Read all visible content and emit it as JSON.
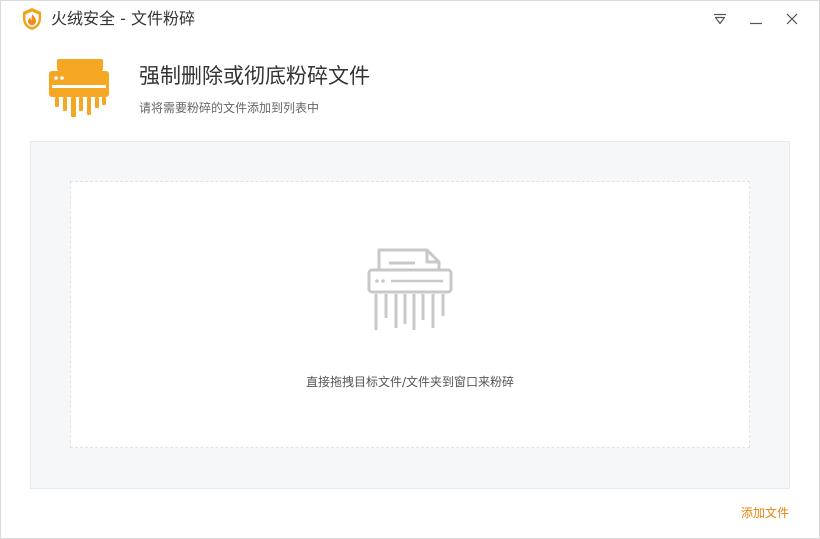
{
  "window": {
    "title": "火绒安全 - 文件粉碎",
    "logo_icon": "huorong-flame-logo",
    "controls": {
      "menu_icon": "dropdown-menu-icon",
      "minimize_icon": "minimize-icon",
      "close_icon": "close-icon"
    }
  },
  "header": {
    "icon": "shredder-icon",
    "title": "强制删除或彻底粉碎文件",
    "subtitle": "请将需要粉碎的文件添加到列表中"
  },
  "drop_area": {
    "icon": "shredder-outline-icon",
    "hint": "直接拖拽目标文件/文件夹到窗口来粉碎"
  },
  "footer": {
    "add_file_label": "添加文件"
  },
  "colors": {
    "accent": "#f5a623",
    "link": "#e8820c",
    "drop_bg": "#f6f7f8",
    "icon_gray": "#c8c8c8"
  }
}
